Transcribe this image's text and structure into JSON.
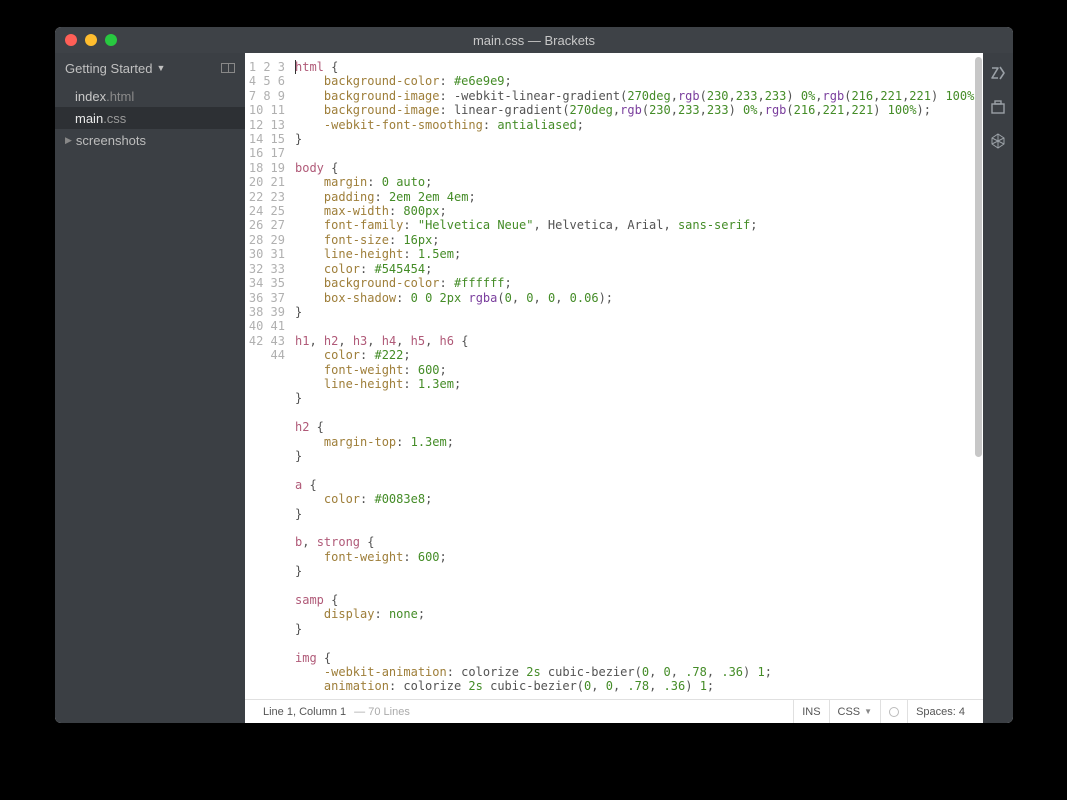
{
  "title": "main.css — Brackets",
  "sidebar": {
    "header": "Getting Started",
    "files": [
      {
        "name": "index",
        "ext": ".html",
        "active": false
      },
      {
        "name": "main",
        "ext": ".css",
        "active": true
      }
    ],
    "folders": [
      {
        "name": "screenshots"
      }
    ]
  },
  "editor": {
    "line_count": 44,
    "code_lines": [
      [
        [
          "selector",
          "html"
        ],
        [
          "punct",
          " {"
        ]
      ],
      [
        [
          "indent",
          "    "
        ],
        [
          "prop",
          "background-color"
        ],
        [
          "punct",
          ": "
        ],
        [
          "color",
          "#e6e9e9"
        ],
        [
          "punct",
          ";"
        ]
      ],
      [
        [
          "indent",
          "    "
        ],
        [
          "prop",
          "background-image"
        ],
        [
          "punct",
          ": -webkit-linear-gradient("
        ],
        [
          "num",
          "270deg"
        ],
        [
          "punct",
          ","
        ],
        [
          "func",
          "rgb"
        ],
        [
          "punct",
          "("
        ],
        [
          "num",
          "230"
        ],
        [
          "punct",
          ","
        ],
        [
          "num",
          "233"
        ],
        [
          "punct",
          ","
        ],
        [
          "num",
          "233"
        ],
        [
          "punct",
          ") "
        ],
        [
          "num",
          "0%"
        ],
        [
          "punct",
          ","
        ],
        [
          "func",
          "rgb"
        ],
        [
          "punct",
          "("
        ],
        [
          "num",
          "216"
        ],
        [
          "punct",
          ","
        ],
        [
          "num",
          "221"
        ],
        [
          "punct",
          ","
        ],
        [
          "num",
          "221"
        ],
        [
          "punct",
          ") "
        ],
        [
          "num",
          "100%"
        ],
        [
          "punct",
          ");"
        ]
      ],
      [
        [
          "indent",
          "    "
        ],
        [
          "prop",
          "background-image"
        ],
        [
          "punct",
          ": linear-gradient("
        ],
        [
          "num",
          "270deg"
        ],
        [
          "punct",
          ","
        ],
        [
          "func",
          "rgb"
        ],
        [
          "punct",
          "("
        ],
        [
          "num",
          "230"
        ],
        [
          "punct",
          ","
        ],
        [
          "num",
          "233"
        ],
        [
          "punct",
          ","
        ],
        [
          "num",
          "233"
        ],
        [
          "punct",
          ") "
        ],
        [
          "num",
          "0%"
        ],
        [
          "punct",
          ","
        ],
        [
          "func",
          "rgb"
        ],
        [
          "punct",
          "("
        ],
        [
          "num",
          "216"
        ],
        [
          "punct",
          ","
        ],
        [
          "num",
          "221"
        ],
        [
          "punct",
          ","
        ],
        [
          "num",
          "221"
        ],
        [
          "punct",
          ") "
        ],
        [
          "num",
          "100%"
        ],
        [
          "punct",
          ");"
        ]
      ],
      [
        [
          "indent",
          "    "
        ],
        [
          "prop",
          "-webkit-font-smoothing"
        ],
        [
          "punct",
          ": "
        ],
        [
          "val",
          "antialiased"
        ],
        [
          "punct",
          ";"
        ]
      ],
      [
        [
          "punct",
          "}"
        ]
      ],
      [],
      [
        [
          "selector",
          "body"
        ],
        [
          "punct",
          " {"
        ]
      ],
      [
        [
          "indent",
          "    "
        ],
        [
          "prop",
          "margin"
        ],
        [
          "punct",
          ": "
        ],
        [
          "num",
          "0"
        ],
        [
          "punct",
          " "
        ],
        [
          "val",
          "auto"
        ],
        [
          "punct",
          ";"
        ]
      ],
      [
        [
          "indent",
          "    "
        ],
        [
          "prop",
          "padding"
        ],
        [
          "punct",
          ": "
        ],
        [
          "num",
          "2em"
        ],
        [
          "punct",
          " "
        ],
        [
          "num",
          "2em"
        ],
        [
          "punct",
          " "
        ],
        [
          "num",
          "4em"
        ],
        [
          "punct",
          ";"
        ]
      ],
      [
        [
          "indent",
          "    "
        ],
        [
          "prop",
          "max-width"
        ],
        [
          "punct",
          ": "
        ],
        [
          "num",
          "800px"
        ],
        [
          "punct",
          ";"
        ]
      ],
      [
        [
          "indent",
          "    "
        ],
        [
          "prop",
          "font-family"
        ],
        [
          "punct",
          ": "
        ],
        [
          "string",
          "\"Helvetica Neue\""
        ],
        [
          "punct",
          ", Helvetica, Arial, "
        ],
        [
          "val",
          "sans-serif"
        ],
        [
          "punct",
          ";"
        ]
      ],
      [
        [
          "indent",
          "    "
        ],
        [
          "prop",
          "font-size"
        ],
        [
          "punct",
          ": "
        ],
        [
          "num",
          "16px"
        ],
        [
          "punct",
          ";"
        ]
      ],
      [
        [
          "indent",
          "    "
        ],
        [
          "prop",
          "line-height"
        ],
        [
          "punct",
          ": "
        ],
        [
          "num",
          "1.5em"
        ],
        [
          "punct",
          ";"
        ]
      ],
      [
        [
          "indent",
          "    "
        ],
        [
          "prop",
          "color"
        ],
        [
          "punct",
          ": "
        ],
        [
          "color",
          "#545454"
        ],
        [
          "punct",
          ";"
        ]
      ],
      [
        [
          "indent",
          "    "
        ],
        [
          "prop",
          "background-color"
        ],
        [
          "punct",
          ": "
        ],
        [
          "color",
          "#ffffff"
        ],
        [
          "punct",
          ";"
        ]
      ],
      [
        [
          "indent",
          "    "
        ],
        [
          "prop",
          "box-shadow"
        ],
        [
          "punct",
          ": "
        ],
        [
          "num",
          "0"
        ],
        [
          "punct",
          " "
        ],
        [
          "num",
          "0"
        ],
        [
          "punct",
          " "
        ],
        [
          "num",
          "2px"
        ],
        [
          "punct",
          " "
        ],
        [
          "func",
          "rgba"
        ],
        [
          "punct",
          "("
        ],
        [
          "num",
          "0"
        ],
        [
          "punct",
          ", "
        ],
        [
          "num",
          "0"
        ],
        [
          "punct",
          ", "
        ],
        [
          "num",
          "0"
        ],
        [
          "punct",
          ", "
        ],
        [
          "num",
          "0.06"
        ],
        [
          "punct",
          ");"
        ]
      ],
      [
        [
          "punct",
          "}"
        ]
      ],
      [],
      [
        [
          "selector",
          "h1"
        ],
        [
          "punct",
          ", "
        ],
        [
          "selector",
          "h2"
        ],
        [
          "punct",
          ", "
        ],
        [
          "selector",
          "h3"
        ],
        [
          "punct",
          ", "
        ],
        [
          "selector",
          "h4"
        ],
        [
          "punct",
          ", "
        ],
        [
          "selector",
          "h5"
        ],
        [
          "punct",
          ", "
        ],
        [
          "selector",
          "h6"
        ],
        [
          "punct",
          " {"
        ]
      ],
      [
        [
          "indent",
          "    "
        ],
        [
          "prop",
          "color"
        ],
        [
          "punct",
          ": "
        ],
        [
          "color",
          "#222"
        ],
        [
          "punct",
          ";"
        ]
      ],
      [
        [
          "indent",
          "    "
        ],
        [
          "prop",
          "font-weight"
        ],
        [
          "punct",
          ": "
        ],
        [
          "num",
          "600"
        ],
        [
          "punct",
          ";"
        ]
      ],
      [
        [
          "indent",
          "    "
        ],
        [
          "prop",
          "line-height"
        ],
        [
          "punct",
          ": "
        ],
        [
          "num",
          "1.3em"
        ],
        [
          "punct",
          ";"
        ]
      ],
      [
        [
          "punct",
          "}"
        ]
      ],
      [],
      [
        [
          "selector",
          "h2"
        ],
        [
          "punct",
          " {"
        ]
      ],
      [
        [
          "indent",
          "    "
        ],
        [
          "prop",
          "margin-top"
        ],
        [
          "punct",
          ": "
        ],
        [
          "num",
          "1.3em"
        ],
        [
          "punct",
          ";"
        ]
      ],
      [
        [
          "punct",
          "}"
        ]
      ],
      [],
      [
        [
          "selector",
          "a"
        ],
        [
          "punct",
          " {"
        ]
      ],
      [
        [
          "indent",
          "    "
        ],
        [
          "prop",
          "color"
        ],
        [
          "punct",
          ": "
        ],
        [
          "color",
          "#0083e8"
        ],
        [
          "punct",
          ";"
        ]
      ],
      [
        [
          "punct",
          "}"
        ]
      ],
      [],
      [
        [
          "selector",
          "b"
        ],
        [
          "punct",
          ", "
        ],
        [
          "selector",
          "strong"
        ],
        [
          "punct",
          " {"
        ]
      ],
      [
        [
          "indent",
          "    "
        ],
        [
          "prop",
          "font-weight"
        ],
        [
          "punct",
          ": "
        ],
        [
          "num",
          "600"
        ],
        [
          "punct",
          ";"
        ]
      ],
      [
        [
          "punct",
          "}"
        ]
      ],
      [],
      [
        [
          "selector",
          "samp"
        ],
        [
          "punct",
          " {"
        ]
      ],
      [
        [
          "indent",
          "    "
        ],
        [
          "prop",
          "display"
        ],
        [
          "punct",
          ": "
        ],
        [
          "val",
          "none"
        ],
        [
          "punct",
          ";"
        ]
      ],
      [
        [
          "punct",
          "}"
        ]
      ],
      [],
      [
        [
          "selector",
          "img"
        ],
        [
          "punct",
          " {"
        ]
      ],
      [
        [
          "indent",
          "    "
        ],
        [
          "prop",
          "-webkit-animation"
        ],
        [
          "punct",
          ": colorize "
        ],
        [
          "num",
          "2s"
        ],
        [
          "punct",
          " cubic-bezier("
        ],
        [
          "num",
          "0"
        ],
        [
          "punct",
          ", "
        ],
        [
          "num",
          "0"
        ],
        [
          "punct",
          ", "
        ],
        [
          "num",
          ".78"
        ],
        [
          "punct",
          ", "
        ],
        [
          "num",
          ".36"
        ],
        [
          "punct",
          ") "
        ],
        [
          "num",
          "1"
        ],
        [
          "punct",
          ";"
        ]
      ],
      [
        [
          "indent",
          "    "
        ],
        [
          "prop",
          "animation"
        ],
        [
          "punct",
          ": colorize "
        ],
        [
          "num",
          "2s"
        ],
        [
          "punct",
          " cubic-bezier("
        ],
        [
          "num",
          "0"
        ],
        [
          "punct",
          ", "
        ],
        [
          "num",
          "0"
        ],
        [
          "punct",
          ", "
        ],
        [
          "num",
          ".78"
        ],
        [
          "punct",
          ", "
        ],
        [
          "num",
          ".36"
        ],
        [
          "punct",
          ") "
        ],
        [
          "num",
          "1"
        ],
        [
          "punct",
          ";"
        ]
      ]
    ]
  },
  "statusbar": {
    "position": "Line 1, Column 1",
    "lines": "— 70 Lines",
    "ins": "INS",
    "lang": "CSS",
    "spaces": "Spaces: 4"
  }
}
